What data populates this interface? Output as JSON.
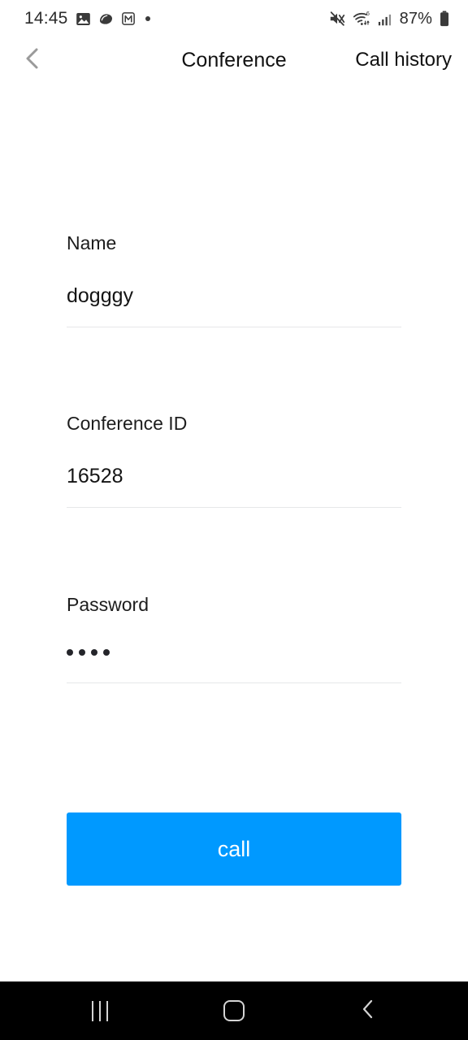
{
  "status_bar": {
    "time": "14:45",
    "left_icons": [
      "gallery-icon",
      "shell-icon",
      "m-badge-icon",
      "dot-indicator-icon"
    ],
    "right_icons": [
      "mute-icon",
      "wifi-6-icon",
      "cellular-signal-icon"
    ],
    "wifi_generation": "6",
    "battery_percent": "87%"
  },
  "header": {
    "back_icon": "chevron-left-icon",
    "title": "Conference",
    "call_history_label": "Call history"
  },
  "form": {
    "name": {
      "label": "Name",
      "value": "dogggy"
    },
    "conference_id": {
      "label": "Conference ID",
      "value": "16528"
    },
    "password": {
      "label": "Password",
      "value": "••••",
      "dot_count": 4
    },
    "call_button": {
      "label": "call",
      "color": "#0099FF",
      "text_color": "#FFFFFF"
    }
  },
  "nav_bar": {
    "recents_label": "recents-icon",
    "home_label": "home-icon",
    "back_label": "back-icon",
    "background": "#000000"
  }
}
